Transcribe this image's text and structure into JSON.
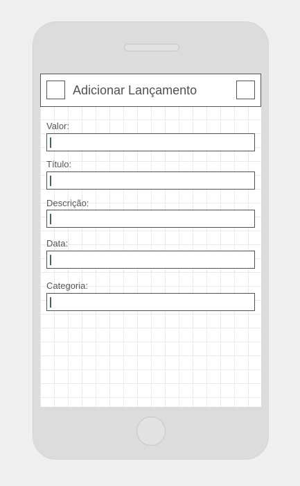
{
  "header": {
    "title": "Adicionar Lançamento"
  },
  "form": {
    "fields": [
      {
        "label": "Valor:",
        "value": ""
      },
      {
        "label": "Título:",
        "value": ""
      },
      {
        "label": "Descrição:",
        "value": ""
      },
      {
        "label": "Data:",
        "value": ""
      },
      {
        "label": "Categoria:",
        "value": ""
      }
    ]
  }
}
